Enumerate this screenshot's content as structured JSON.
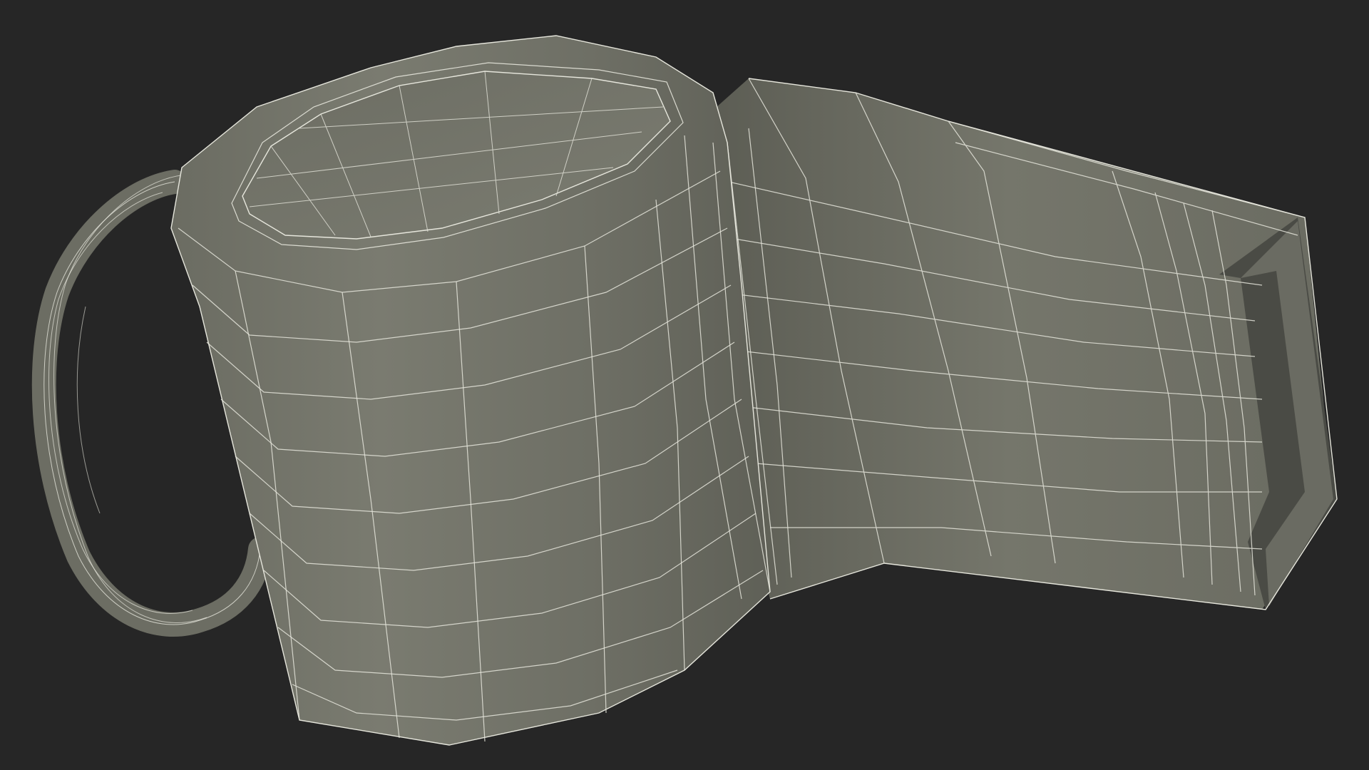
{
  "scene": {
    "subject": "whistle-wireframe-model",
    "colors": {
      "background": "#262626",
      "surface": "#737469",
      "surface_dark": "#5c5d53",
      "surface_light": "#818277",
      "inner": "#4f504a",
      "wire": "#e6e6dc"
    }
  }
}
